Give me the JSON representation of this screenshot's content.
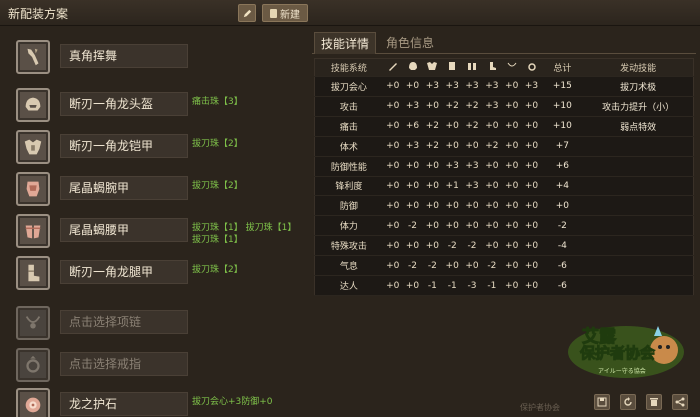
{
  "header": {
    "title": "新配装方案",
    "new_label": "新建"
  },
  "gear": [
    {
      "slot": "weapon",
      "name": "真角挥舞",
      "skills": [],
      "icon": "insect-glaive-icon"
    },
    {
      "slot": "head",
      "name": "断刃一角龙头盔",
      "skills": [
        "痛击珠【3】"
      ],
      "icon": "helmet-icon"
    },
    {
      "slot": "chest",
      "name": "断刃一角龙铠甲",
      "skills": [
        "拔刀珠【2】"
      ],
      "icon": "chest-armor-icon"
    },
    {
      "slot": "arms",
      "name": "尾晶蝎腕甲",
      "skills": [
        "拔刀珠【2】"
      ],
      "icon": "arm-armor-icon"
    },
    {
      "slot": "waist",
      "name": "尾晶蝎腰甲",
      "skills": [
        "拔刀珠【1】 拔刀珠【1】",
        "拔刀珠【1】"
      ],
      "icon": "waist-armor-icon"
    },
    {
      "slot": "legs",
      "name": "断刃一角龙腿甲",
      "skills": [
        "拔刀珠【2】"
      ],
      "icon": "leg-armor-icon"
    },
    {
      "slot": "necklace",
      "name": "点击选择项链",
      "skills": [],
      "icon": "necklace-icon",
      "empty": true
    },
    {
      "slot": "ring",
      "name": "点击选择戒指",
      "skills": [],
      "icon": "ring-icon",
      "empty": true
    },
    {
      "slot": "charm",
      "name": "龙之护石",
      "skills": [
        "拔刀会心+3防御+0"
      ],
      "icon": "charm-icon"
    }
  ],
  "tabs": [
    {
      "label": "技能详情",
      "active": true
    },
    {
      "label": "角色信息",
      "active": false
    }
  ],
  "skill_table": {
    "headers": {
      "skill": "技能系统",
      "total": "总计",
      "active": "发动技能"
    },
    "column_icons": [
      "weapon-icon",
      "helmet-icon",
      "chest-armor-icon",
      "arm-armor-icon",
      "waist-armor-icon",
      "leg-armor-icon",
      "necklace-icon",
      "ring-icon"
    ],
    "rows": [
      {
        "skill": "拔刀会心",
        "vals": [
          "+0",
          "+0",
          "+3",
          "+3",
          "+3",
          "+3",
          "+0",
          "+3"
        ],
        "total": "+15",
        "active": "拔刀术极"
      },
      {
        "skill": "攻击",
        "vals": [
          "+0",
          "+3",
          "+0",
          "+2",
          "+2",
          "+3",
          "+0",
          "+0"
        ],
        "total": "+10",
        "active": "攻击力提升（小）"
      },
      {
        "skill": "痛击",
        "vals": [
          "+0",
          "+6",
          "+2",
          "+0",
          "+2",
          "+0",
          "+0",
          "+0"
        ],
        "total": "+10",
        "active": "弱点特效"
      },
      {
        "skill": "体术",
        "vals": [
          "+0",
          "+3",
          "+2",
          "+0",
          "+0",
          "+2",
          "+0",
          "+0"
        ],
        "total": "+7",
        "active": ""
      },
      {
        "skill": "防御性能",
        "vals": [
          "+0",
          "+0",
          "+0",
          "+3",
          "+3",
          "+0",
          "+0",
          "+0"
        ],
        "total": "+6",
        "active": ""
      },
      {
        "skill": "锋利度",
        "vals": [
          "+0",
          "+0",
          "+0",
          "+1",
          "+3",
          "+0",
          "+0",
          "+0"
        ],
        "total": "+4",
        "active": ""
      },
      {
        "skill": "防御",
        "vals": [
          "+0",
          "+0",
          "+0",
          "+0",
          "+0",
          "+0",
          "+0",
          "+0"
        ],
        "total": "+0",
        "active": ""
      },
      {
        "skill": "体力",
        "vals": [
          "+0",
          "-2",
          "+0",
          "+0",
          "+0",
          "+0",
          "+0",
          "+0"
        ],
        "total": "-2",
        "active": ""
      },
      {
        "skill": "特殊攻击",
        "vals": [
          "+0",
          "+0",
          "+0",
          "-2",
          "-2",
          "+0",
          "+0",
          "+0"
        ],
        "total": "-4",
        "active": ""
      },
      {
        "skill": "气息",
        "vals": [
          "+0",
          "-2",
          "-2",
          "+0",
          "+0",
          "-2",
          "+0",
          "+0"
        ],
        "total": "-6",
        "active": ""
      },
      {
        "skill": "达人",
        "vals": [
          "+0",
          "+0",
          "-1",
          "-1",
          "-3",
          "-1",
          "+0",
          "+0"
        ],
        "total": "-6",
        "active": ""
      }
    ]
  },
  "logo": {
    "line1": "艾露",
    "line2": "保护者协会",
    "sub": "アイルー守る協会"
  },
  "bottom_text": "保护者协会"
}
